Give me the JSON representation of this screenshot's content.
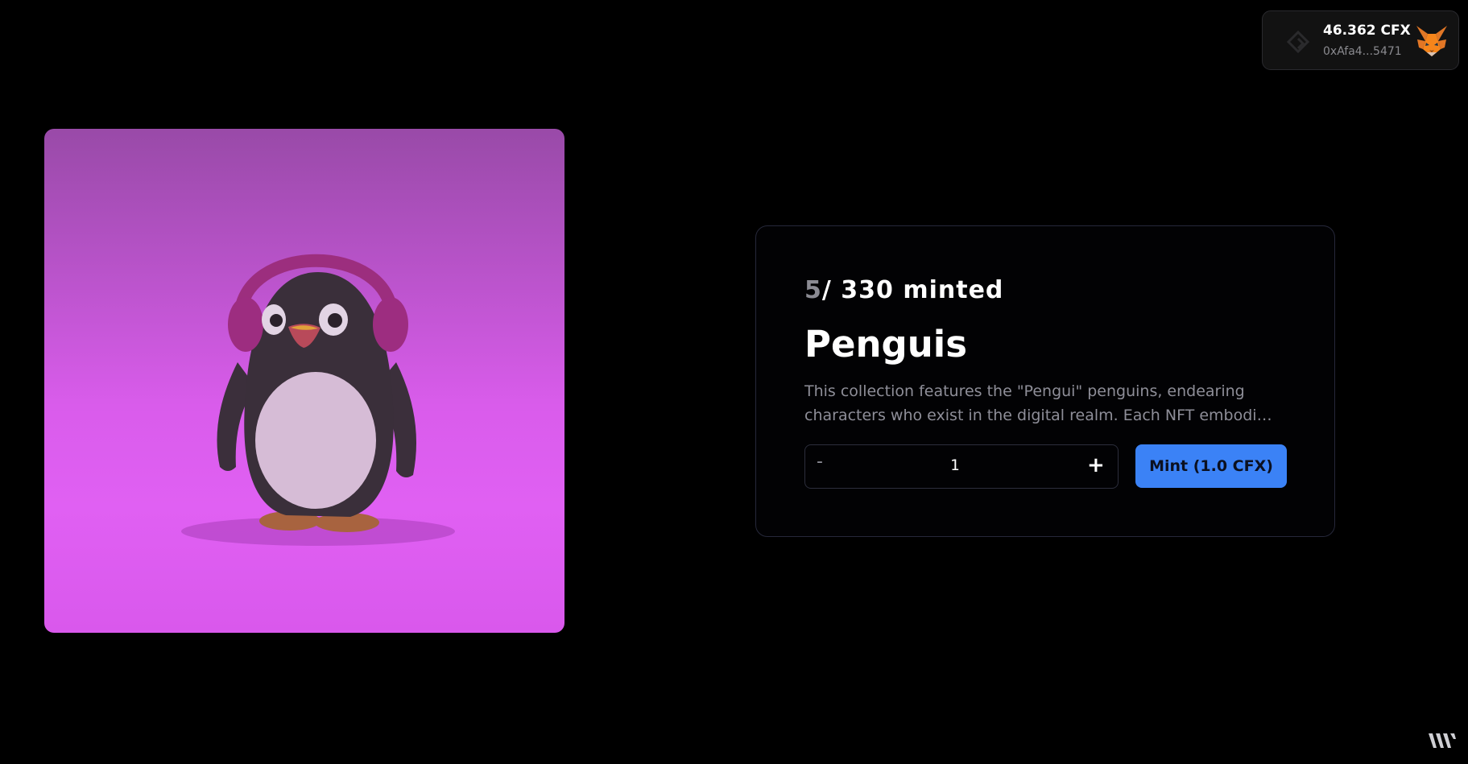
{
  "wallet": {
    "balance": "46.362 CFX",
    "address": "0xAfa4...5471",
    "chain_icon": "conflux-icon",
    "wallet_icon": "metamask-fox-icon"
  },
  "nft": {
    "image_subject": "penguin-with-headphones",
    "minted_count": "5",
    "minted_total": "/ 330 minted",
    "title": "Penguis",
    "description_line1": "This collection features the \"Pengui\" penguins, endearing",
    "description_line2": "characters who exist in the digital realm. Each NFT embodies a..."
  },
  "mint": {
    "decrement_label": "-",
    "quantity": "1",
    "increment_label": "+",
    "button_label": "Mint (1.0 CFX)"
  },
  "colors": {
    "accent": "#3b82f6",
    "background": "#000000",
    "image_bg_top": "#994aa8",
    "image_bg_bottom": "#e060f3"
  },
  "footer": {
    "brand_icon": "thirdweb-logo-icon"
  }
}
